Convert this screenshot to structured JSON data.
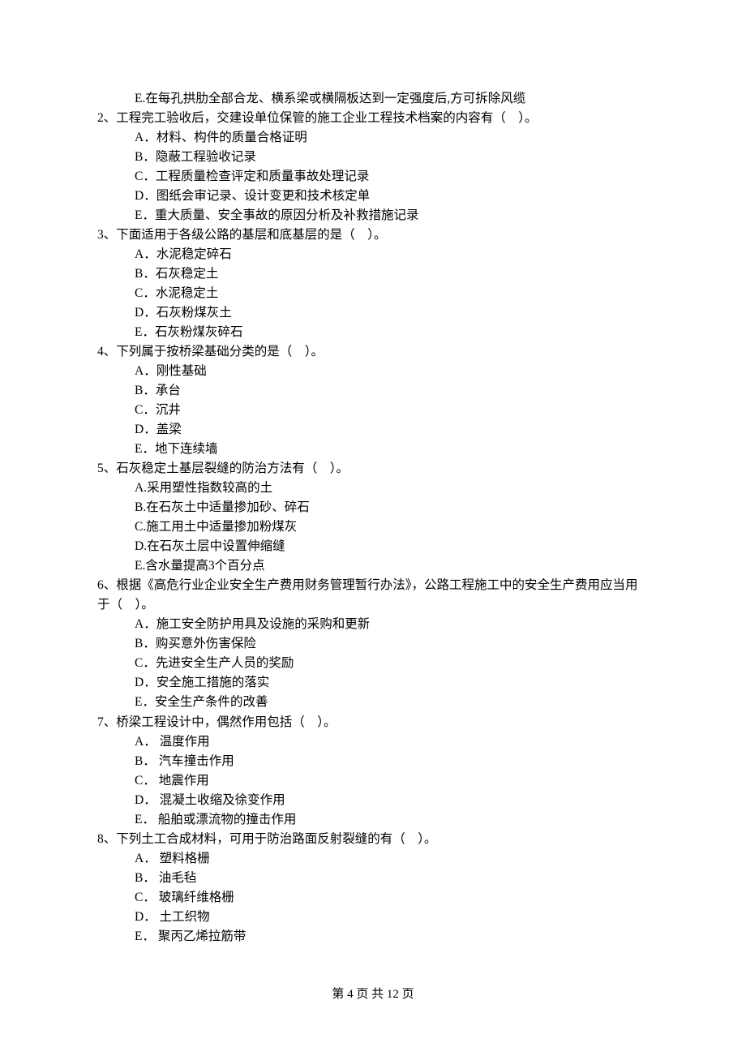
{
  "lines": {
    "q1_optE": "E.在每孔拱肋全部合龙、横系梁戓横隔板达到一定强度后,方可拆除风缆",
    "q2_stem": "2、工程完工验收后，交建设单位保管的施工企业工程技术档案的内容有（    ）。",
    "q2_A": "A．材料、构件的质量合格证明",
    "q2_B": "B．隐蔽工程验收记录",
    "q2_C": "C．工程质量检查评定和质量事故处理记录",
    "q2_D": "D．图纸会审记录、设计变更和技术核定单",
    "q2_E": "E．重大质量、安全事故的原因分析及补救措施记录",
    "q3_stem": "3、下面适用于各级公路的基层和底基层的是（    ）。",
    "q3_A": "A．水泥稳定碎石",
    "q3_B": "B．石灰稳定土",
    "q3_C": "C．水泥稳定土",
    "q3_D": "D．石灰粉煤灰土",
    "q3_E": "E．石灰粉煤灰碎石",
    "q4_stem": "4、下列属于按桥梁基础分类的是（    ）。",
    "q4_A": "A．刚性基础",
    "q4_B": "B．承台",
    "q4_C": "C．沉井",
    "q4_D": "D．盖梁",
    "q4_E": "E．地下连续墙",
    "q5_stem": "5、石灰稳定土基层裂缝的防治方法有（    ）。",
    "q5_A": "A.采用塑性指数较高的土",
    "q5_B": "B.在石灰土中适量掺加砂、碎石",
    "q5_C": "C.施工用土中适量掺加粉煤灰",
    "q5_D": "D.在石灰土层中设置伸缩缝",
    "q5_E": "E.含水量提高3个百分点",
    "q6_stem": "6、根据《高危行业企业安全生产费用财务管理暂行办法》，公路工程施工中的安全生产费用应当用于（    ）。",
    "q6_A": "A．施工安全防护用具及设施的采购和更新",
    "q6_B": "B．购买意外伤害保险",
    "q6_C": "C．先进安全生产人员的奖励",
    "q6_D": "D．安全施工措施的落实",
    "q6_E": "E．安全生产条件的改善",
    "q7_stem": "7、桥梁工程设计中，偶然作用包括（    ）。",
    "q7_A": "A． 温度作用",
    "q7_B": "B． 汽车撞击作用",
    "q7_C": "C． 地震作用",
    "q7_D": "D． 混凝土收缩及徐变作用",
    "q7_E": "E． 船舶或漂流物的撞击作用",
    "q8_stem": "8、下列土工合成材料，可用于防治路面反射裂缝的有（    ）。",
    "q8_A": "A． 塑料格栅",
    "q8_B": "B． 油毛毡",
    "q8_C": "C． 玻璃纤维格栅",
    "q8_D": "D． 土工织物",
    "q8_E": "E． 聚丙乙烯拉筋带"
  },
  "footer": "第 4 页 共 12 页"
}
